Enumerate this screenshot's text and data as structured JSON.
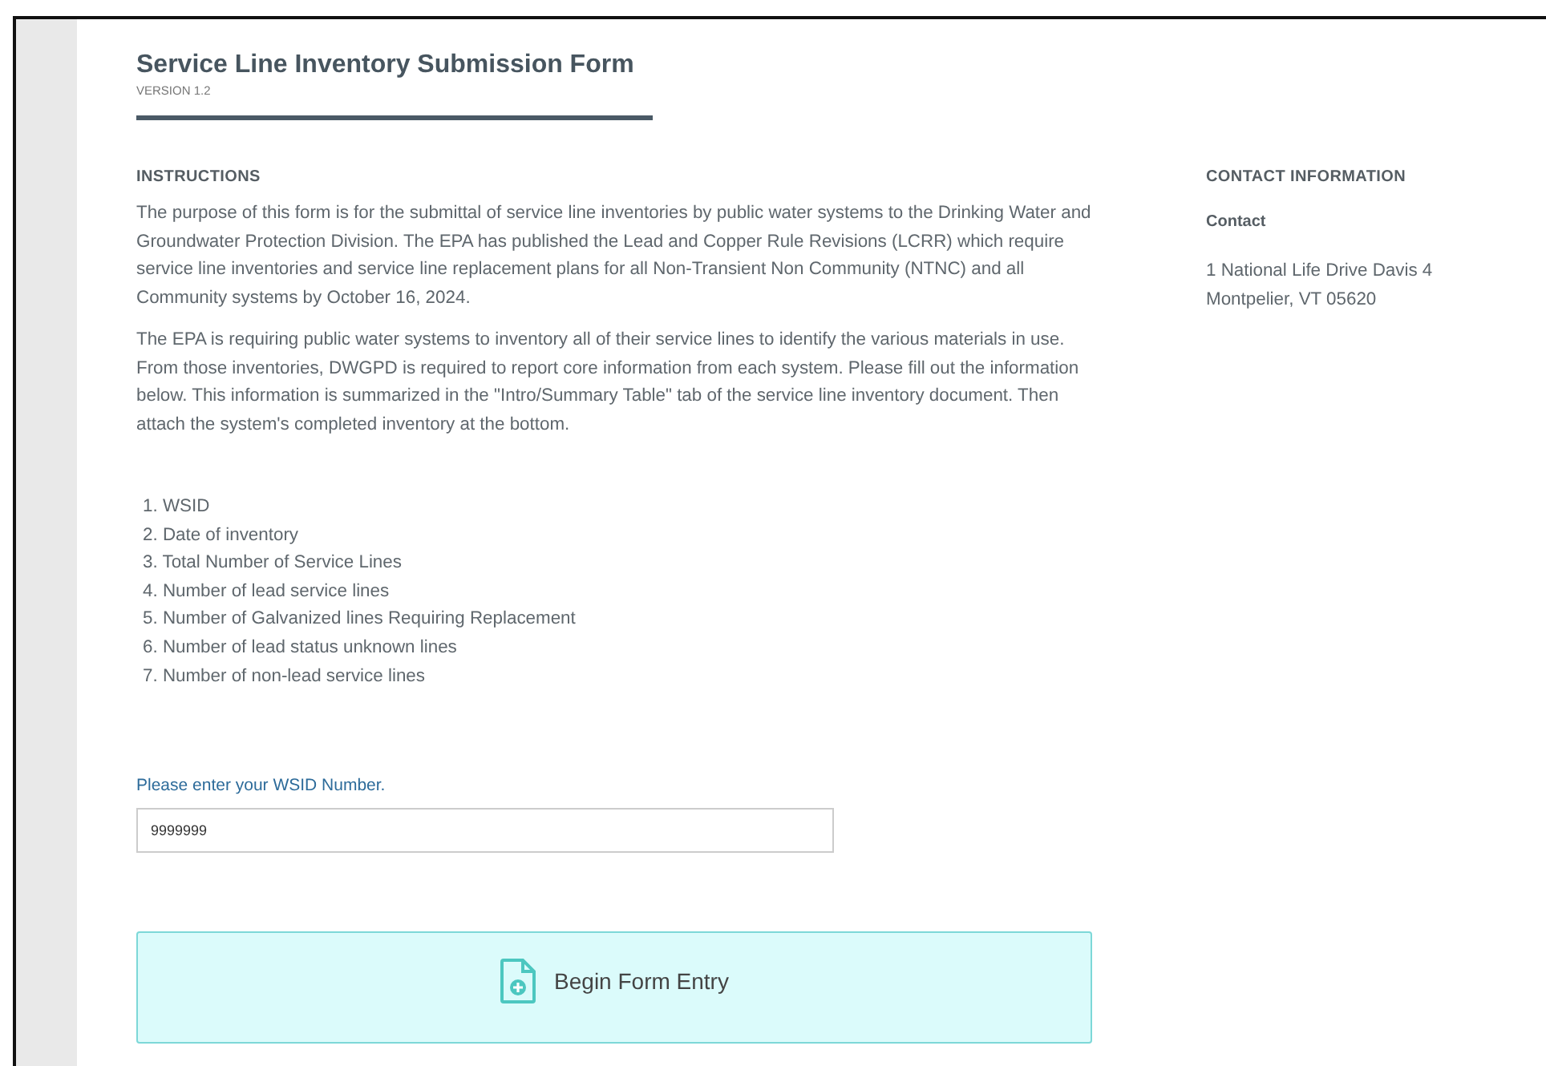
{
  "header": {
    "title": "Service Line Inventory Submission Form",
    "version": "VERSION 1.2"
  },
  "instructions": {
    "heading": "INSTRUCTIONS",
    "paragraphs": [
      "The purpose of this form is for the submittal of service line inventories by public water systems to the Drinking Water and Groundwater Protection Division. The EPA has published the Lead and Copper Rule Revisions (LCRR) which require service line inventories and service line replacement plans for all Non-Transient Non Community (NTNC) and all Community systems by October 16, 2024.",
      "The EPA is requiring public water systems to inventory all of their service lines to identify the various materials in use. From those inventories, DWGPD is required to report core information from each system. Please fill out the information below. This information is summarized in the \"Intro/Summary Table\" tab of the service line inventory document. Then attach the system's completed inventory at the bottom."
    ],
    "list": [
      "1. WSID",
      "2. Date of inventory",
      "3. Total Number of Service Lines",
      "4. Number of lead service lines",
      "5. Number of Galvanized lines Requiring Replacement",
      "6. Number of lead status unknown lines",
      "7. Number of non-lead service lines"
    ]
  },
  "wsid_field": {
    "label": "Please enter your WSID Number.",
    "value": "9999999"
  },
  "begin_button": {
    "label": "Begin Form Entry"
  },
  "contact": {
    "heading": "CONTACT INFORMATION",
    "name": "Contact",
    "address": [
      "1 National Life Drive Davis 4",
      "Montpelier, VT 05620"
    ]
  }
}
